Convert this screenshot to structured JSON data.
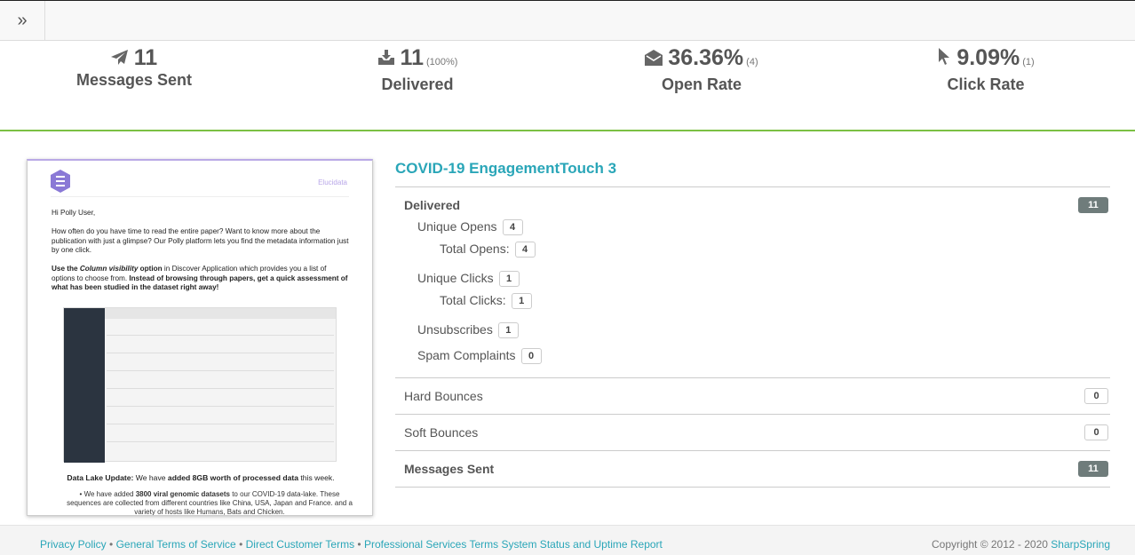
{
  "stats": [
    {
      "value": "11",
      "sub": "",
      "label": "Messages Sent",
      "icon": "paper-plane-icon"
    },
    {
      "value": "11",
      "sub": "(100%)",
      "label": "Delivered",
      "icon": "download-tray-icon"
    },
    {
      "value": "36.36%",
      "sub": "(4)",
      "label": "Open Rate",
      "icon": "open-envelope-icon"
    },
    {
      "value": "9.09%",
      "sub": "(1)",
      "label": "Click Rate",
      "icon": "cursor-icon"
    }
  ],
  "preview": {
    "brand": "Elucidata",
    "greeting": "Hi Polly User,",
    "para1": "How often do you have time to read the entire paper? Want to know more about the publication with just a glimpse? Our Polly platform lets you find the metadata information just by one click.",
    "para2_bold1": "Use the ",
    "para2_italic": "Column visibility",
    "para2_bold2": " option",
    "para2_mid": " in Discover Application which provides you a list of options to choose from. ",
    "para2_bold3": "Instead of browsing through papers, get a quick assessment of what has been studied in the dataset right away!",
    "lake_bold": "Data Lake Update:",
    "lake_mid": " We have ",
    "lake_bold2": "added 8GB worth of processed data",
    "lake_end": " this week.",
    "bullet_a": "We have added ",
    "bullet_bold": "3800 viral genomic datasets",
    "bullet_b": " to our COVID-19 data-lake. These sequences are collected from different countries like China, USA, Japan and France. and a variety of hosts like Humans, Bats and Chicken."
  },
  "detail": {
    "title": "COVID-19 EngagementTouch 3",
    "delivered": {
      "label": "Delivered",
      "count": "11"
    },
    "unique_opens": {
      "label": "Unique Opens",
      "count": "4"
    },
    "total_opens": {
      "label": "Total Opens:",
      "count": "4"
    },
    "unique_clicks": {
      "label": "Unique Clicks",
      "count": "1"
    },
    "total_clicks": {
      "label": "Total Clicks:",
      "count": "1"
    },
    "unsubscribes": {
      "label": "Unsubscribes",
      "count": "1"
    },
    "spam": {
      "label": "Spam Complaints",
      "count": "0"
    },
    "hard_bounces": {
      "label": "Hard Bounces",
      "count": "0"
    },
    "soft_bounces": {
      "label": "Soft Bounces",
      "count": "0"
    },
    "messages_sent": {
      "label": "Messages Sent",
      "count": "11"
    }
  },
  "footer": {
    "privacy": "Privacy Policy",
    "sep": " • ",
    "general": "General Terms of Service",
    "direct": "Direct Customer Terms",
    "professional": "Professional Services Terms",
    "status": "System Status and Uptime Report",
    "copyright": "Copyright © 2012 - 2020 ",
    "company": "SharpSpring"
  },
  "colors": {
    "accent": "#2aa6b8",
    "divider_green": "#7bc043",
    "badge_dark": "#6f7c7b",
    "brand_purple": "#8a79d6"
  }
}
